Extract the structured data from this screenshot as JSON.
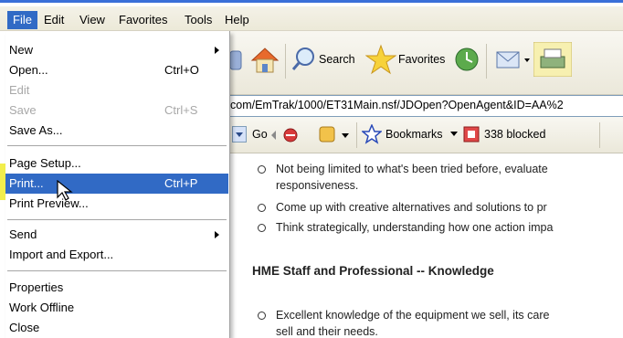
{
  "menubar": {
    "items": [
      "File",
      "Edit",
      "View",
      "Favorites",
      "Tools",
      "Help"
    ]
  },
  "toolbar": {
    "search_label": "Search",
    "favorites_label": "Favorites"
  },
  "address": {
    "url": "com/EmTrak/1000/ET31Main.nsf/JDOpen?OpenAgent&ID=AA%2"
  },
  "links_bar": {
    "go_label": "Go",
    "bookmarks_label": "Bookmarks",
    "blocked_label": "338 blocked"
  },
  "file_menu": {
    "new": "New",
    "open": "Open...",
    "open_shortcut": "Ctrl+O",
    "edit": "Edit",
    "save": "Save",
    "save_shortcut": "Ctrl+S",
    "save_as": "Save As...",
    "page_setup": "Page Setup...",
    "print": "Print...",
    "print_shortcut": "Ctrl+P",
    "print_preview": "Print Preview...",
    "send": "Send",
    "import_export": "Import and Export...",
    "properties": "Properties",
    "work_offline": "Work Offline",
    "close": "Close"
  },
  "content": {
    "bullet1_line1": "Not being limited to what's been tried before, evaluate",
    "bullet1_line2": "responsiveness.",
    "bullet2": "Come up with creative alternatives and solutions to pr",
    "bullet3": "Think strategically, understanding how one action impa",
    "heading": "HME Staff and Professional -- Knowledge",
    "bullet4_line1": "Excellent knowledge of the equipment we sell, its care",
    "bullet4_line2": "sell and their needs."
  },
  "colors": {
    "menu_highlight": "#316ac5",
    "marker_yellow": "#f2ee4c"
  }
}
